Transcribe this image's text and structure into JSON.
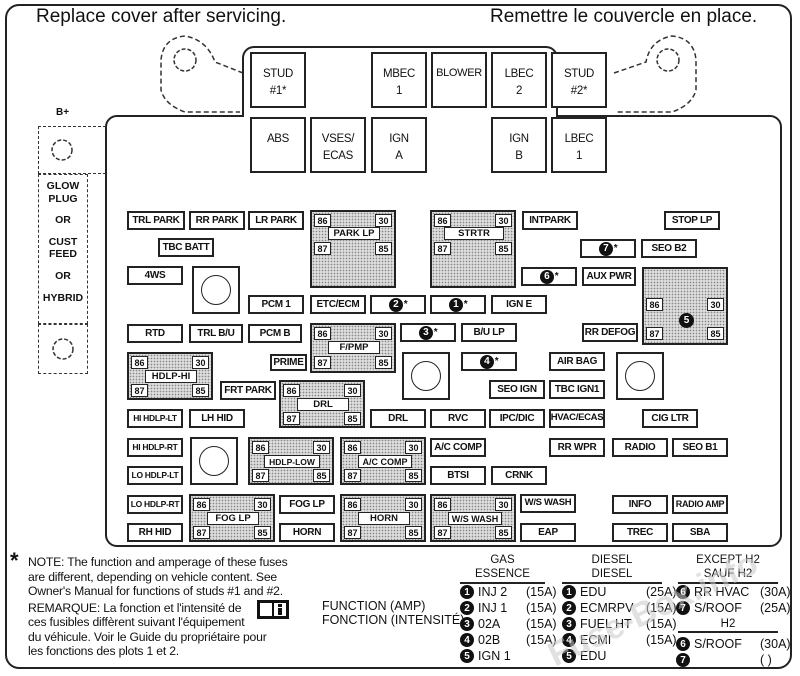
{
  "header": {
    "left_title": "Replace cover after servicing.",
    "right_title": "Remettre le couvercle en place."
  },
  "side": {
    "b_plus": "B+",
    "lines": [
      "GLOW",
      "PLUG",
      "OR",
      "CUST",
      "FEED",
      "OR",
      "HYBRID"
    ]
  },
  "top_row": [
    {
      "id": "stud1",
      "l1": "STUD",
      "l2": "#1*"
    },
    {
      "id": "mbec1",
      "l1": "MBEC",
      "l2": "1"
    },
    {
      "id": "blower",
      "l1": "BLOWER",
      "l2": ""
    },
    {
      "id": "lbec2",
      "l1": "LBEC",
      "l2": "2"
    },
    {
      "id": "stud2",
      "l1": "STUD",
      "l2": "#2*"
    }
  ],
  "second_row": [
    {
      "id": "abs",
      "l1": "ABS",
      "l2": ""
    },
    {
      "id": "vses",
      "l1": "VSES/",
      "l2": "ECAS"
    },
    {
      "id": "igna",
      "l1": "IGN",
      "l2": "A"
    },
    {
      "id": "ignb",
      "l1": "IGN",
      "l2": "B"
    },
    {
      "id": "lbec1",
      "l1": "LBEC",
      "l2": "1"
    }
  ],
  "fuses": {
    "trl_park": "TRL PARK",
    "rr_park": "RR PARK",
    "lr_park": "LR PARK",
    "tbc_batt": "TBC BATT",
    "4ws": "4WS",
    "pcm1": "PCM 1",
    "etc_ecm": "ETC/ECM",
    "intpark": "INTPARK",
    "stop_lp": "STOP LP",
    "seo_b2": "SEO B2",
    "aux_pwr": "AUX PWR",
    "ign_e": "IGN E",
    "rtd": "RTD",
    "trl_bu": "TRL B/U",
    "pcm_b": "PCM B",
    "bu_lp": "B/U LP",
    "rr_defog": "RR DEFOG",
    "prime": "PRIME",
    "air_bag": "AIR BAG",
    "frt_park": "FRT PARK",
    "seo_ign": "SEO IGN",
    "tbc_ign1": "TBC IGN1",
    "hi_hdlp_lt": "HI HDLP-LT",
    "lh_hid": "LH HID",
    "drl": "DRL",
    "rvc": "RVC",
    "ipc_dic": "IPC/DIC",
    "hvac_ecas": "HVAC/ECAS",
    "cig_ltr": "CIG LTR",
    "hi_hdlp_rt": "HI HDLP-RT",
    "a_c_comp": "A/C COMP",
    "rr_wpr": "RR WPR",
    "radio": "RADIO",
    "seo_b1": "SEO B1",
    "lo_hdlp_lt": "LO HDLP-LT",
    "btsi": "BTSI",
    "crnk": "CRNK",
    "lo_hdlp_rt": "LO HDLP-RT",
    "fog_lp": "FOG LP",
    "ws_wash": "W/S WASH",
    "info": "INFO",
    "radio_amp": "RADIO AMP",
    "rh_hid": "RH HID",
    "horn": "HORN",
    "eap": "EAP",
    "trec": "TREC",
    "sba": "SBA"
  },
  "numbered_fuses": {
    "n1": "1",
    "n2": "2",
    "n3": "3",
    "n4": "4",
    "n6": "6",
    "n7": "7",
    "star": "*"
  },
  "relays": {
    "park_lp": "PARK LP",
    "strtr": "STRTR",
    "f_pmp": "F/PMP",
    "hdlp_hi": "HDLP-HI",
    "drl": "DRL",
    "hdlp_low": "HDLP-LOW",
    "a_c_comp": "A/C COMP",
    "fog_lp": "FOG LP",
    "horn": "HORN",
    "ws_wash": "W/S WASH",
    "relay5": "5"
  },
  "pins": {
    "p86": "86",
    "p30": "30",
    "p87": "87",
    "p85": "85"
  },
  "note": {
    "star": "*",
    "lines": [
      "NOTE: The function and amperage of these fuses",
      "are different, depending on vehicle content. See",
      "Owner's Manual for functions of studs #1 and #2.",
      "REMARQUE: La fonction et l'intensité de",
      "ces fusibles diffèrent suivant l'équipement",
      "du véhicule. Voir le Guide du propriétaire pour",
      "les fonctions des plots 1 et 2."
    ]
  },
  "function_label": {
    "en": "FUNCTION (AMP)",
    "fr": "FONCTION (INTENSITÉ)"
  },
  "legend": {
    "gas": {
      "h1": "GAS",
      "h2": "ESSENCE",
      "rows": [
        {
          "n": "1",
          "name": "INJ 2",
          "amp": "(15A)"
        },
        {
          "n": "2",
          "name": "INJ 1",
          "amp": "(15A)"
        },
        {
          "n": "3",
          "name": "02A",
          "amp": "(15A)"
        },
        {
          "n": "4",
          "name": "02B",
          "amp": "(15A)"
        },
        {
          "n": "5",
          "name": "IGN 1",
          "amp": ""
        }
      ]
    },
    "diesel": {
      "h1": "DIESEL",
      "h2": "DIESEL",
      "rows": [
        {
          "n": "1",
          "name": "EDU",
          "amp": "(25A)"
        },
        {
          "n": "2",
          "name": "ECMRPV",
          "amp": "(15A)"
        },
        {
          "n": "3",
          "name": "FUEL HT",
          "amp": "(15A)"
        },
        {
          "n": "4",
          "name": "ECMI",
          "amp": "(15A)"
        },
        {
          "n": "5",
          "name": "EDU",
          "amp": ""
        }
      ]
    },
    "except_h2": {
      "h1": "EXCEPT H2",
      "h2": "SAUF H2",
      "rows": [
        {
          "n": "6",
          "name": "RR HVAC",
          "amp": "(30A)"
        },
        {
          "n": "7",
          "name": "S/ROOF",
          "amp": "(25A)"
        }
      ]
    },
    "h2": {
      "h1": "H2",
      "rows": [
        {
          "n": "6",
          "name": "S/ROOF",
          "amp": "(30A)"
        },
        {
          "n": "7",
          "name": "",
          "amp": "(    )"
        }
      ]
    }
  },
  "watermark": "Fuse-Box.info"
}
